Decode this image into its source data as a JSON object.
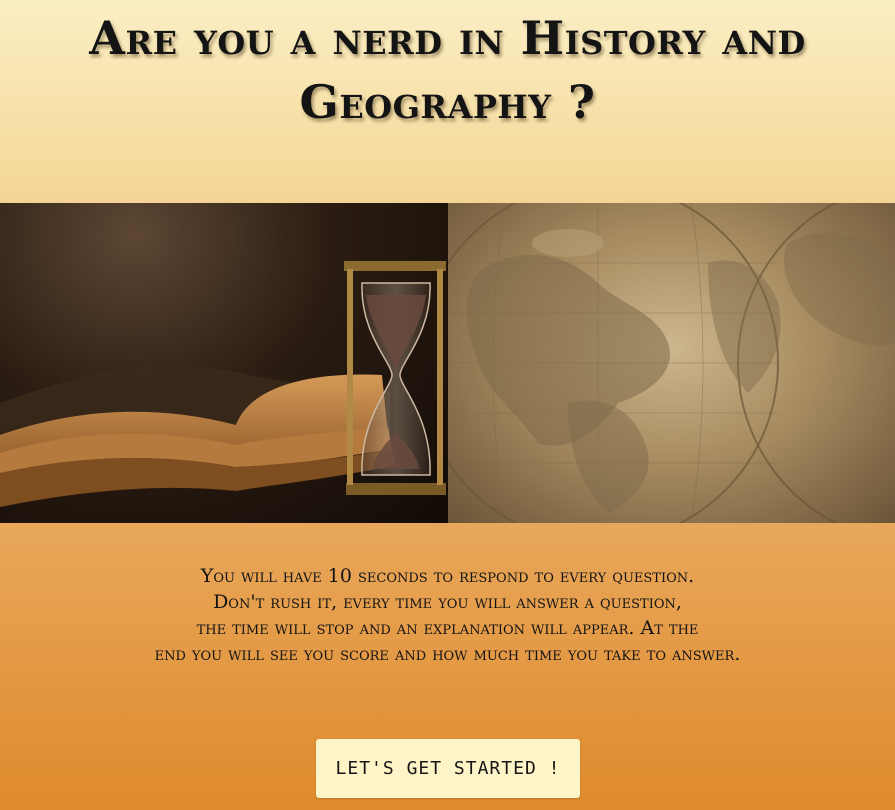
{
  "page": {
    "title": "Are you a nerd in History and Geography ?",
    "intro_lines": [
      "You will have 10 seconds to respond to every question.",
      "Don't rush it, every time you will answer a question,",
      "the time will stop and an explanation will appear. At the",
      "end you will see you score and how much time you take to answer."
    ],
    "start_button_label": "LET'S GET STARTED !"
  },
  "hero": {
    "left_image": "book-and-hourglass-image",
    "right_image": "antique-world-map-image"
  },
  "colors": {
    "background_top": "#fbeec4",
    "background_bottom": "#df8a2c",
    "button_background": "#fdf4c8",
    "text": "#141414"
  }
}
